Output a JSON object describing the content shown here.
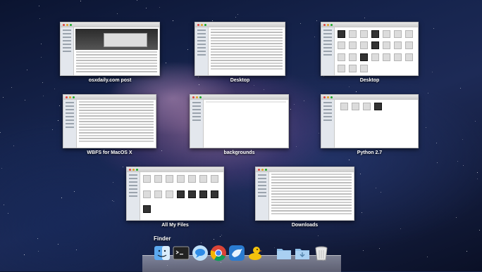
{
  "windows": [
    {
      "label": "osxdaily.com post",
      "style": "browser"
    },
    {
      "label": "Desktop",
      "style": "list"
    },
    {
      "label": "Desktop",
      "style": "icons"
    },
    {
      "label": "WBFS for MacOS X",
      "style": "list"
    },
    {
      "label": "backgrounds",
      "style": "blank"
    },
    {
      "label": "Python 2.7",
      "style": "iconsfew"
    },
    {
      "label": "All My Files",
      "style": "icons"
    },
    {
      "label": "Downloads",
      "style": "list"
    }
  ],
  "app_group": {
    "label": "Finder"
  },
  "dock": {
    "icons": [
      "finder-icon",
      "terminal-icon",
      "messages-icon",
      "chrome-icon",
      "tweetbot-icon",
      "cyberduck-icon",
      "folder-icon",
      "downloads-folder-icon",
      "trash-icon"
    ]
  },
  "colors": {
    "label_text": "#ffffff",
    "close": "#e0443e",
    "minimize": "#dea123",
    "zoom": "#1aab29"
  }
}
